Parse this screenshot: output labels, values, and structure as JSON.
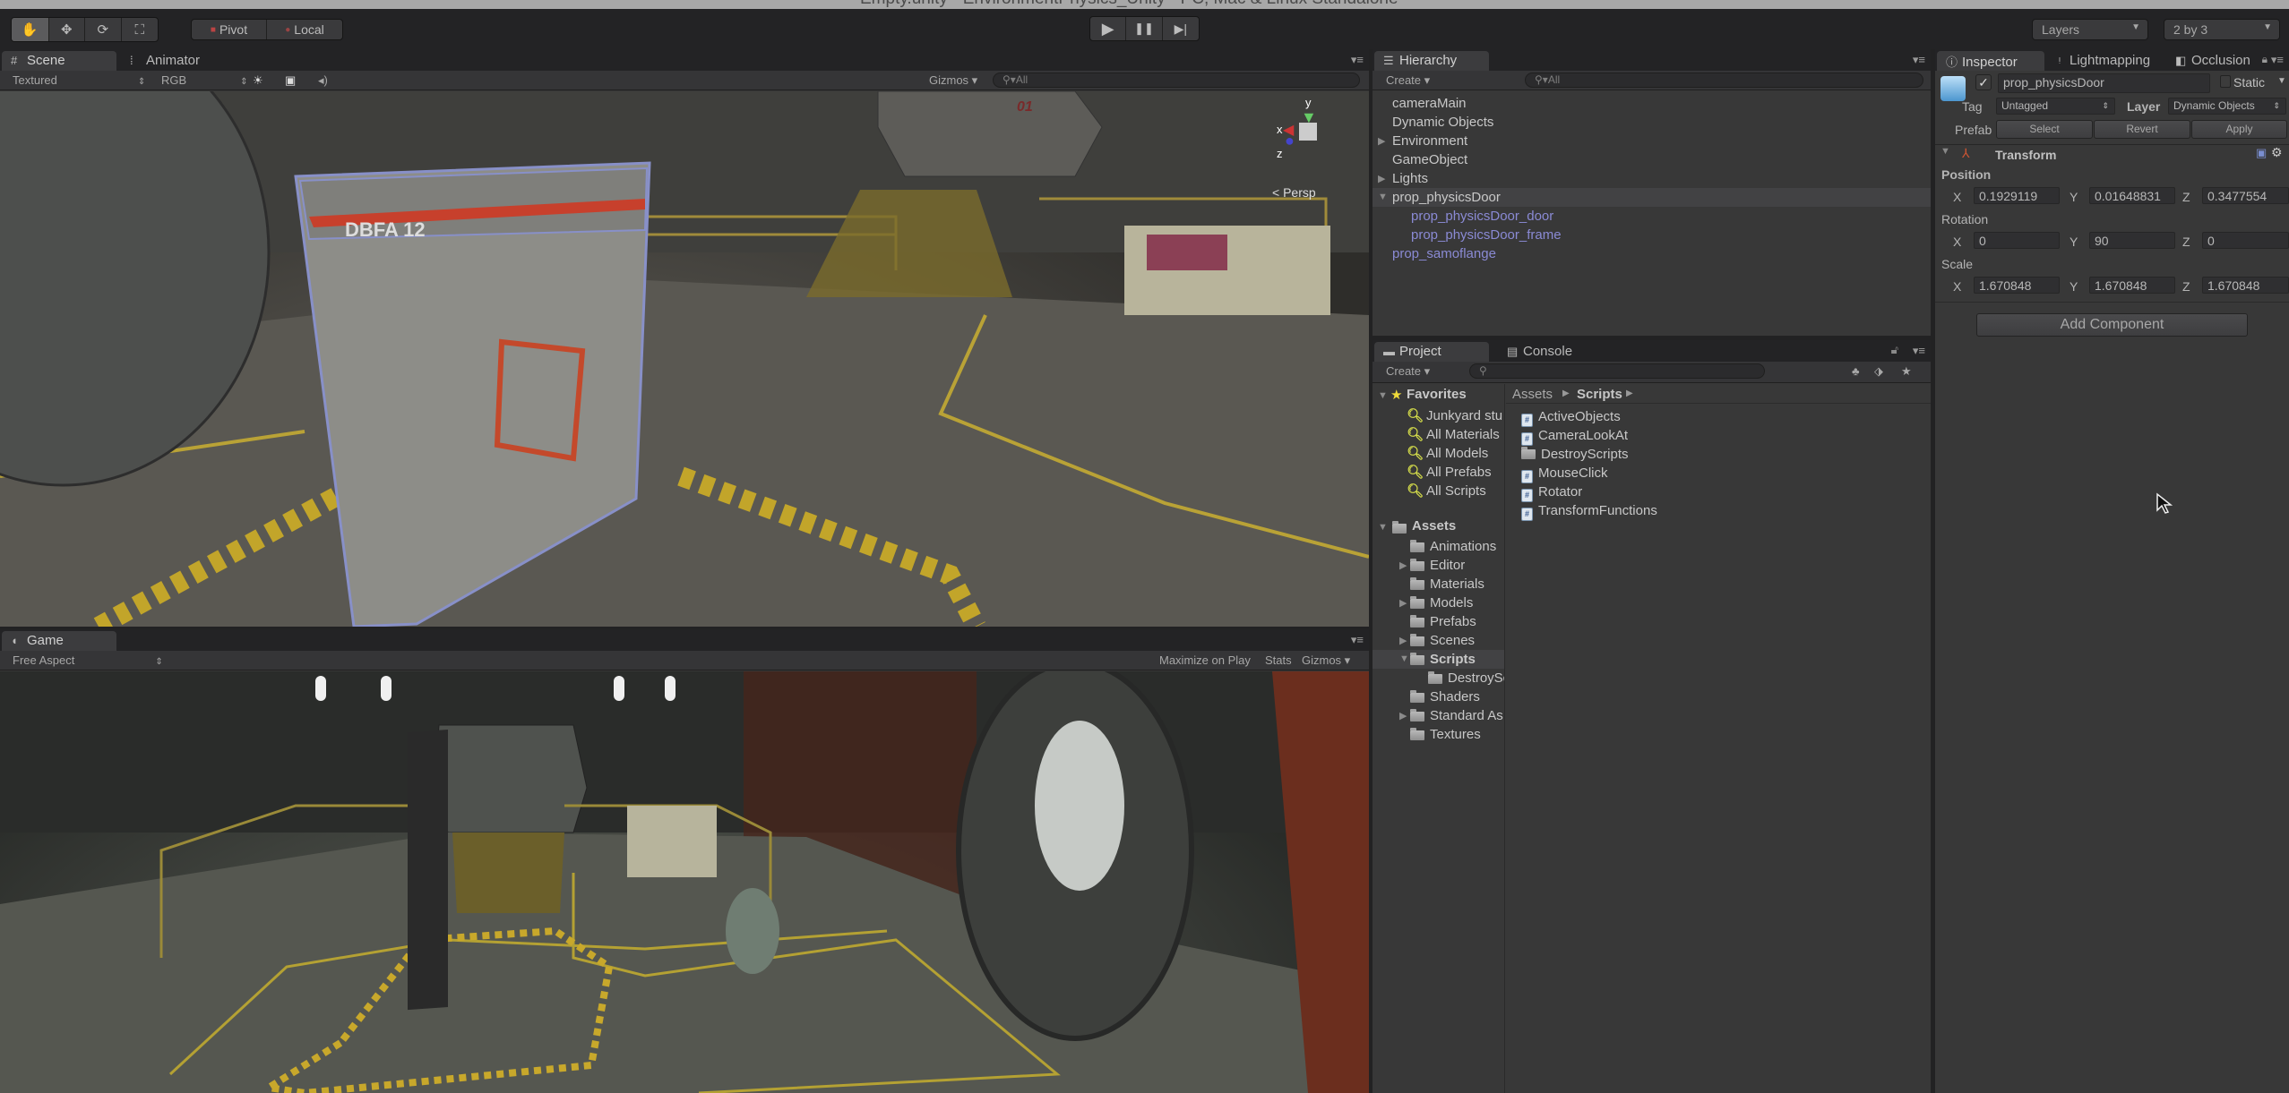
{
  "window": {
    "title": "Empty.unity - EnvironmentPhysics_Unity - PC, Mac & Linux Standalone"
  },
  "toolbar": {
    "tools": [
      {
        "name": "hand",
        "icon": "✋",
        "active": true
      },
      {
        "name": "move",
        "icon": "✥",
        "active": false
      },
      {
        "name": "rotate",
        "icon": "⟳",
        "active": false
      },
      {
        "name": "scale",
        "icon": "⛶",
        "active": false
      }
    ],
    "pivot_label": "Pivot",
    "local_label": "Local",
    "play_icon": "▶",
    "pause_icon": "❚❚",
    "step_icon": "▶|",
    "layers_label": "Layers",
    "layout_label": "2 by 3"
  },
  "scene": {
    "tabs": [
      {
        "label": "Scene",
        "icon": "#",
        "active": true
      },
      {
        "label": "Animator",
        "icon": "⁞",
        "active": false
      }
    ],
    "render_mode": "Textured",
    "color_mode": "RGB",
    "gizmos_label": "Gizmos",
    "search_placeholder": "All",
    "persp_label": "Persp",
    "axes": {
      "x": "x",
      "y": "y",
      "z": "z"
    },
    "door_label": "DBFA 12",
    "wall_number": "01"
  },
  "game": {
    "tab_label": "Game",
    "aspect": "Free Aspect",
    "maximize_label": "Maximize on Play",
    "stats_label": "Stats",
    "gizmos_label": "Gizmos"
  },
  "hierarchy": {
    "tab_label": "Hierarchy",
    "create_label": "Create",
    "search_placeholder": "All",
    "items": [
      {
        "label": "cameraMain",
        "depth": 0,
        "expander": "",
        "kind": "normal"
      },
      {
        "label": "Dynamic Objects",
        "depth": 0,
        "expander": "",
        "kind": "normal"
      },
      {
        "label": "Environment",
        "depth": 0,
        "expander": "▶",
        "kind": "normal"
      },
      {
        "label": "GameObject",
        "depth": 0,
        "expander": "",
        "kind": "normal"
      },
      {
        "label": "Lights",
        "depth": 0,
        "expander": "▶",
        "kind": "normal"
      },
      {
        "label": "prop_physicsDoor",
        "depth": 0,
        "expander": "▼",
        "kind": "selected"
      },
      {
        "label": "prop_physicsDoor_door",
        "depth": 1,
        "expander": "",
        "kind": "prefab"
      },
      {
        "label": "prop_physicsDoor_frame",
        "depth": 1,
        "expander": "",
        "kind": "prefab"
      },
      {
        "label": "prop_samoflange",
        "depth": 0,
        "expander": "",
        "kind": "prefab"
      }
    ]
  },
  "project": {
    "tabs": [
      {
        "label": "Project",
        "active": true
      },
      {
        "label": "Console",
        "active": false
      }
    ],
    "create_label": "Create",
    "favorites": {
      "label": "Favorites",
      "items": [
        "Junkyard stu",
        "All Materials",
        "All Models",
        "All Prefabs",
        "All Scripts"
      ]
    },
    "assets": {
      "label": "Assets",
      "items": [
        {
          "label": "Animations",
          "expander": "",
          "depth": 1
        },
        {
          "label": "Editor",
          "expander": "▶",
          "depth": 1
        },
        {
          "label": "Materials",
          "expander": "",
          "depth": 1
        },
        {
          "label": "Models",
          "expander": "▶",
          "depth": 1
        },
        {
          "label": "Prefabs",
          "expander": "",
          "depth": 1
        },
        {
          "label": "Scenes",
          "expander": "▶",
          "depth": 1
        },
        {
          "label": "Scripts",
          "expander": "▼",
          "depth": 1,
          "selected": true
        },
        {
          "label": "DestroySc",
          "expander": "",
          "depth": 2
        },
        {
          "label": "Shaders",
          "expander": "",
          "depth": 1
        },
        {
          "label": "Standard As",
          "expander": "▶",
          "depth": 1
        },
        {
          "label": "Textures",
          "expander": "",
          "depth": 1
        }
      ]
    },
    "breadcrumb": [
      "Assets",
      "Scripts"
    ],
    "files": [
      {
        "label": "ActiveObjects",
        "type": "script"
      },
      {
        "label": "CameraLookAt",
        "type": "script"
      },
      {
        "label": "DestroyScripts",
        "type": "folder"
      },
      {
        "label": "MouseClick",
        "type": "script"
      },
      {
        "label": "Rotator",
        "type": "script"
      },
      {
        "label": "TransformFunctions",
        "type": "script"
      }
    ]
  },
  "inspector": {
    "tabs": [
      {
        "label": "Inspector",
        "active": true
      },
      {
        "label": "Lightmapping",
        "active": false
      },
      {
        "label": "Occlusion",
        "active": false
      }
    ],
    "object_name": "prop_physicsDoor",
    "active": true,
    "static_label": "Static",
    "tag_label": "Tag",
    "tag_value": "Untagged",
    "layer_label": "Layer",
    "layer_value": "Dynamic Objects",
    "prefab_label": "Prefab",
    "prefab_buttons": [
      "Select",
      "Revert",
      "Apply"
    ],
    "transform": {
      "title": "Transform",
      "position_label": "Position",
      "rotation_label": "Rotation",
      "scale_label": "Scale",
      "position": {
        "x": "0.1929119",
        "y": "0.01648831",
        "z": "0.3477554"
      },
      "rotation": {
        "x": "0",
        "y": "90",
        "z": "0"
      },
      "scale": {
        "x": "1.670848",
        "y": "1.670848",
        "z": "1.670848"
      }
    },
    "add_component_label": "Add Component"
  }
}
